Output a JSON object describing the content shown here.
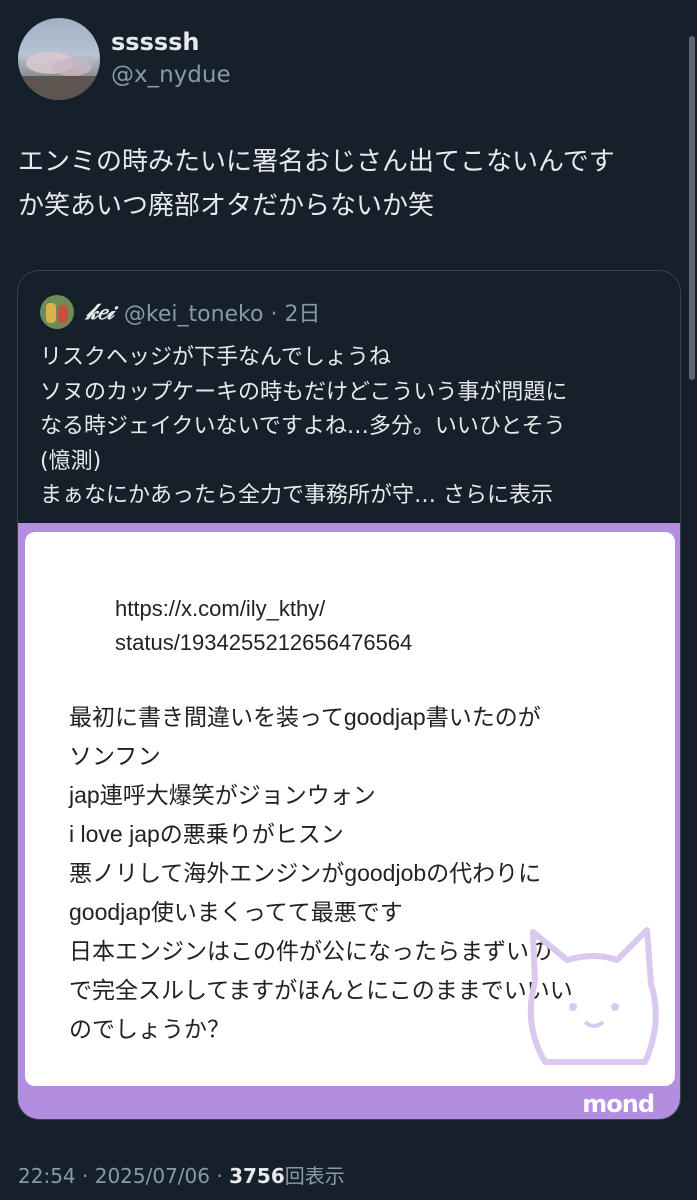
{
  "author": {
    "display_name": "sssssh",
    "handle": "@x_nydue"
  },
  "tweet": {
    "text": "エンミの時みたいに署名おじさん出てこないんです\nか笑あいつ廃部オタだからないか笑"
  },
  "quote": {
    "name": "𝓀𝑒𝒾",
    "meta": "@kei_toneko · 2日",
    "text": "リスクヘッジが下手なんでしょうね\nソヌのカップケーキの時もだけどこういう事が問題に\nなる時ジェイクいないですよね…多分。いいひとそう\n(憶測)\nまぁなにかあったら全力で事務所が守… ",
    "show_more": "さらに表示",
    "image": {
      "url_text": "https://x.com/ily_kthy/\nstatus/1934255212656476564",
      "body_text": "最初に書き間違いを装ってgoodjap書いたのが\nソンフン\njap連呼大爆笑がジョンウォン\ni love japの悪乗りがヒスン\n悪ノリして海外エンジンがgoodjobの代わりに\ngoodjap使いまくってて最悪です\n日本エンジンはこの件が公になったらまずいの\nで完全スルしてますがほんとにこのままでいいい\nのでしょうか？",
      "logo": "mond",
      "frame_color": "#b38de0"
    }
  },
  "footer": {
    "time": "22:54",
    "sep1": " · ",
    "date": "2025/07/06",
    "sep2": " · ",
    "views": "3756",
    "views_label": "回表示"
  },
  "colors": {
    "background": "#15202b",
    "text": "#e7e9ea",
    "secondary": "#8b98a5",
    "border": "#38444d"
  }
}
